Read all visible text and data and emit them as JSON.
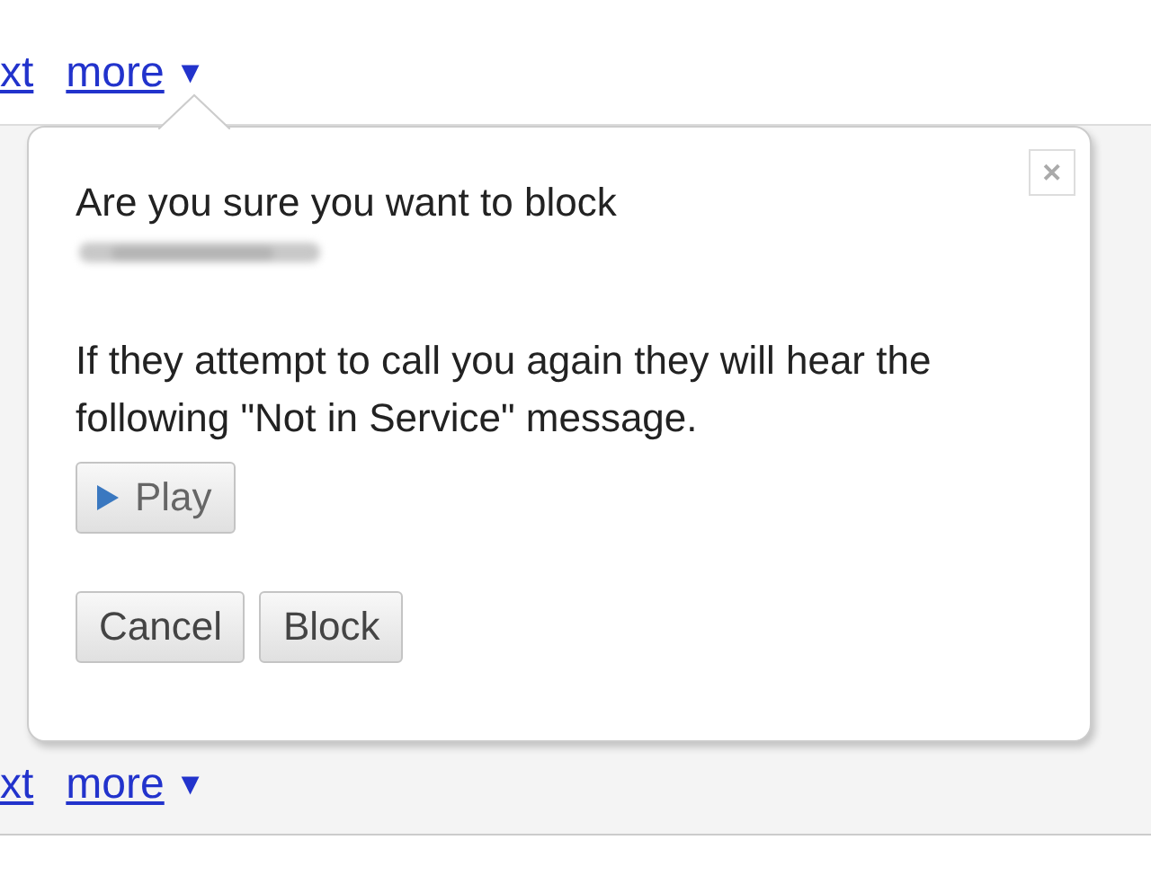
{
  "top_actions": [
    {
      "label": "xt"
    },
    {
      "label": "more",
      "caret": "▼"
    }
  ],
  "bottom_actions": [
    {
      "label": "xt"
    },
    {
      "label": "more",
      "caret": "▼"
    }
  ],
  "dialog": {
    "question": "Are you sure you want to block",
    "number_redacted": true,
    "message": "If they attempt to call you again they will hear the following \"Not in Service\" message.",
    "play_button": "Play",
    "buttons": [
      "Cancel",
      "Block"
    ],
    "close": "✕"
  }
}
